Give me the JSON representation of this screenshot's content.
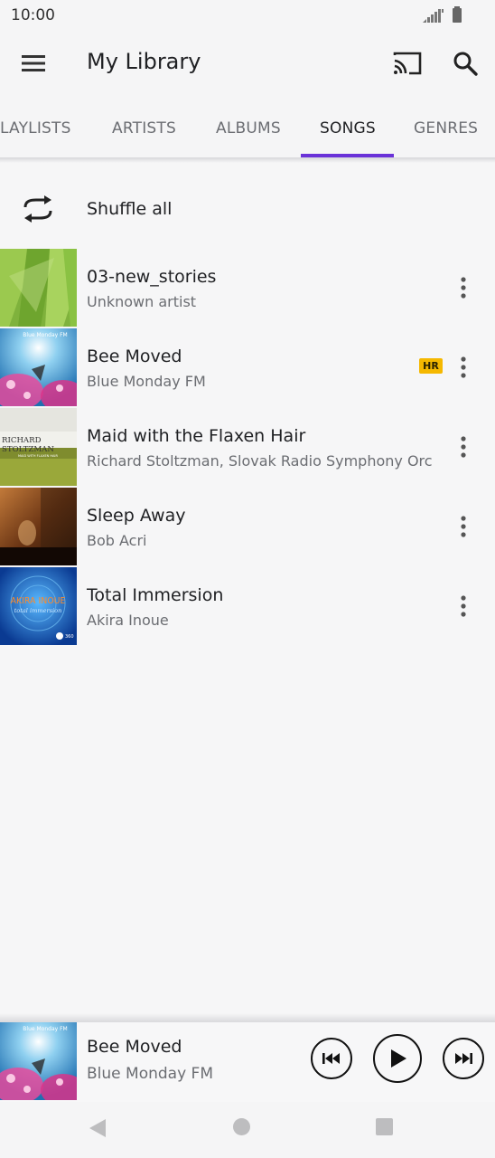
{
  "status_bar": {
    "time": "10:00"
  },
  "app_bar": {
    "title": "My Library"
  },
  "tabs": [
    {
      "label": "LAYLISTS"
    },
    {
      "label": "ARTISTS"
    },
    {
      "label": "ALBUMS"
    },
    {
      "label": "SONGS",
      "active": true
    },
    {
      "label": "GENRES"
    }
  ],
  "shuffle": {
    "label": "Shuffle all"
  },
  "songs": [
    {
      "title": "03-new_stories",
      "artist": "Unknown artist",
      "badge": ""
    },
    {
      "title": "Bee Moved",
      "artist": "Blue Monday FM",
      "badge": "HR"
    },
    {
      "title": "Maid with the Flaxen Hair",
      "artist": "Richard Stoltzman, Slovak Radio Symphony Orc",
      "badge": ""
    },
    {
      "title": "Sleep Away",
      "artist": "Bob Acri",
      "badge": ""
    },
    {
      "title": "Total Immersion",
      "artist": "Akira Inoue",
      "badge": ""
    }
  ],
  "album_art_text": {
    "bee_moved": "Blue Monday FM",
    "maid_line1": "RICHARD",
    "maid_line2": "STOLTZMAN",
    "maid_line3": "MAID WITH FLAXEN HAIR",
    "total_immersion_1": "AKIRA INOUE",
    "total_immersion_2": "total immersion",
    "total_immersion_3": "360"
  },
  "now_playing": {
    "title": "Bee Moved",
    "artist": "Blue Monday FM"
  },
  "colors": {
    "accent": "#6a32d8",
    "hr_badge": "#f5b800"
  }
}
